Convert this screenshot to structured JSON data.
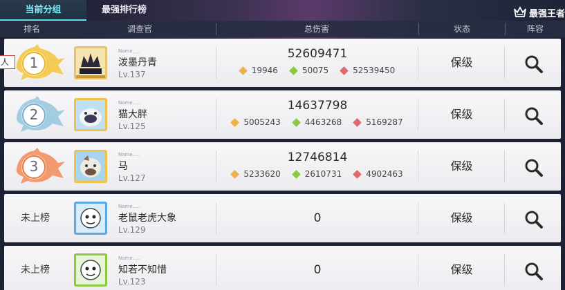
{
  "tabs": [
    {
      "label": "当前分组",
      "active": true
    },
    {
      "label": "最强排行榜",
      "active": false
    }
  ],
  "top_right": {
    "label": "最强王者",
    "icon": "crown-icon"
  },
  "columns": {
    "rank": "排名",
    "investigator": "调查官",
    "total_damage": "总伤害",
    "status": "状态",
    "lineup": "阵容"
  },
  "side_tag": "人",
  "colors": {
    "tab_active_text": "#7ff0f8",
    "gold_badge": "#f5c43a",
    "silver_badge": "#8fc3dc",
    "bronze_badge": "#f28a56",
    "diamond_orange": "#f0b04a",
    "diamond_green": "#8cc840",
    "diamond_red": "#e06a6a"
  },
  "rows": [
    {
      "rank": "1",
      "rank_style": "gold",
      "name_meta": "Name.....",
      "name": "泼墨丹青",
      "level": "Lv.137",
      "total": "52609471",
      "subs": [
        "19946",
        "50075",
        "52539450"
      ],
      "status": "保级"
    },
    {
      "rank": "2",
      "rank_style": "silver",
      "name_meta": "Name.....",
      "name": "猫大胖",
      "level": "Lv.125",
      "total": "14637798",
      "subs": [
        "5005243",
        "4463268",
        "5169287"
      ],
      "status": "保级"
    },
    {
      "rank": "3",
      "rank_style": "bronze",
      "name_meta": "Name.....",
      "name": "马",
      "level": "Lv.127",
      "total": "12746814",
      "subs": [
        "5233620",
        "2610731",
        "4902463"
      ],
      "status": "保级"
    },
    {
      "rank": "未上榜",
      "rank_style": "none",
      "name_meta": "Name.....",
      "name": "老鼠老虎大象",
      "level": "Lv.129",
      "total": "0",
      "subs": [],
      "status": "保级"
    },
    {
      "rank": "未上榜",
      "rank_style": "none",
      "name_meta": "Name.....",
      "name": "知若不知惜",
      "level": "Lv.123",
      "total": "0",
      "subs": [],
      "status": "保级"
    }
  ]
}
